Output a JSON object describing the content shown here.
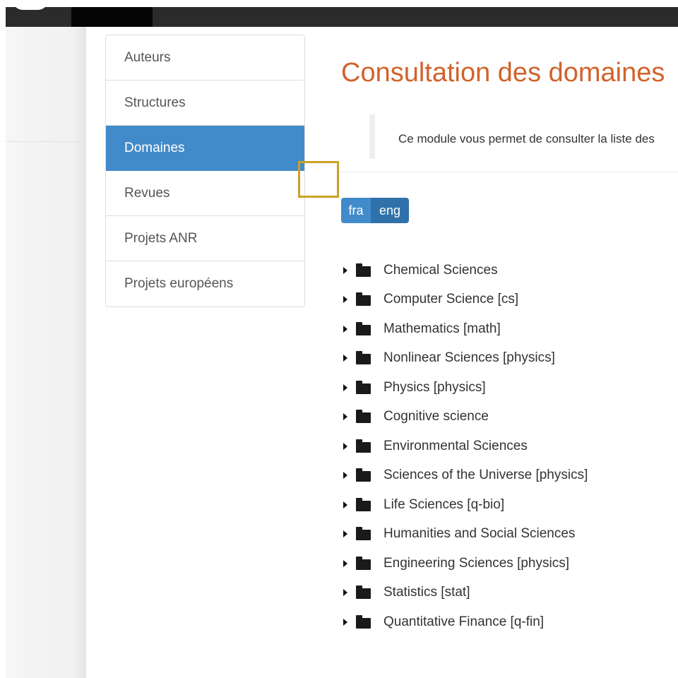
{
  "sidebar": {
    "items": [
      {
        "label": "Auteurs"
      },
      {
        "label": "Structures"
      },
      {
        "label": "Domaines"
      },
      {
        "label": "Revues"
      },
      {
        "label": "Projets ANR"
      },
      {
        "label": "Projets européens"
      }
    ],
    "active": "Domaines"
  },
  "main": {
    "title": "Consultation des domaines",
    "description": "Ce module vous permet de consulter la liste des",
    "languages": {
      "fra": "fra",
      "eng": "eng",
      "selected": "eng"
    },
    "domains": [
      {
        "label": "Chemical Sciences"
      },
      {
        "label": "Computer Science [cs]"
      },
      {
        "label": "Mathematics [math]"
      },
      {
        "label": "Nonlinear Sciences [physics]"
      },
      {
        "label": "Physics [physics]"
      },
      {
        "label": "Cognitive science"
      },
      {
        "label": "Environmental Sciences"
      },
      {
        "label": "Sciences of the Universe [physics]"
      },
      {
        "label": "Life Sciences [q-bio]"
      },
      {
        "label": "Humanities and Social Sciences"
      },
      {
        "label": "Engineering Sciences [physics]"
      },
      {
        "label": "Statistics [stat]"
      },
      {
        "label": "Quantitative Finance [q-fin]"
      }
    ]
  },
  "colors": {
    "accent": "#428bca",
    "title": "#d2622b",
    "topbar": "#2b2b2b"
  },
  "icons": {
    "tree_expander": "caret-right-icon",
    "tree_node": "folder-icon"
  }
}
